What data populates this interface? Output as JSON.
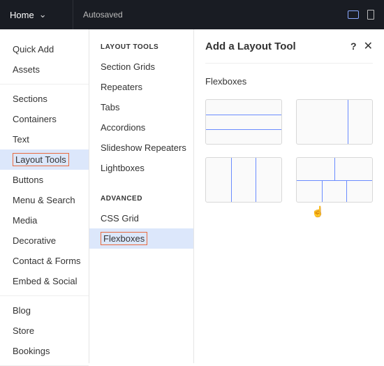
{
  "topbar": {
    "home_label": "Home",
    "status": "Autosaved"
  },
  "sidebar1": {
    "groups": [
      {
        "items": [
          {
            "label": "Quick Add"
          },
          {
            "label": "Assets"
          }
        ]
      },
      {
        "items": [
          {
            "label": "Sections"
          },
          {
            "label": "Containers"
          },
          {
            "label": "Text"
          },
          {
            "label": "Layout Tools",
            "selected": true,
            "highlighted": true
          },
          {
            "label": "Buttons"
          },
          {
            "label": "Menu & Search"
          },
          {
            "label": "Media"
          },
          {
            "label": "Decorative"
          },
          {
            "label": "Contact & Forms"
          },
          {
            "label": "Embed & Social"
          }
        ]
      },
      {
        "items": [
          {
            "label": "Blog"
          },
          {
            "label": "Store"
          },
          {
            "label": "Bookings"
          }
        ]
      }
    ]
  },
  "sidebar2": {
    "sections": [
      {
        "heading": "LAYOUT TOOLS",
        "items": [
          {
            "label": "Section Grids"
          },
          {
            "label": "Repeaters"
          },
          {
            "label": "Tabs"
          },
          {
            "label": "Accordions"
          },
          {
            "label": "Slideshow Repeaters"
          },
          {
            "label": "Lightboxes"
          }
        ]
      },
      {
        "heading": "ADVANCED",
        "items": [
          {
            "label": "CSS Grid"
          },
          {
            "label": "Flexboxes",
            "selected": true,
            "highlighted": true
          }
        ]
      }
    ]
  },
  "panel": {
    "title": "Add a Layout Tool",
    "subheading": "Flexboxes",
    "tiles": [
      {
        "kind": "rows"
      },
      {
        "kind": "onecol"
      },
      {
        "kind": "threecol"
      },
      {
        "kind": "mix"
      }
    ]
  }
}
